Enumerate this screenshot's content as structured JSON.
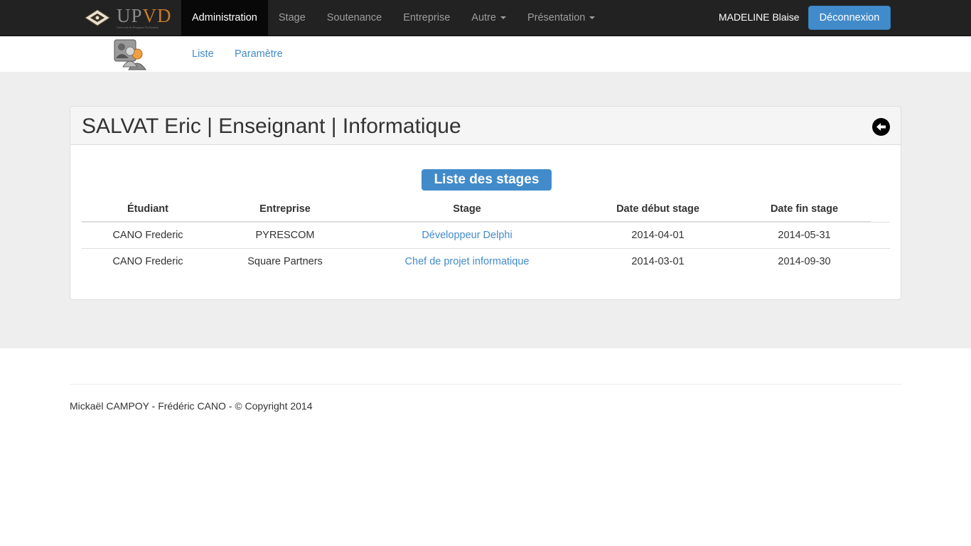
{
  "brand": {
    "letters_up": "UP",
    "letters_vd": "VD",
    "subtitle": "Université de Perpignan Via Domitia"
  },
  "nav": {
    "items": [
      {
        "label": "Administration",
        "active": true,
        "dropdown": false
      },
      {
        "label": "Stage",
        "active": false,
        "dropdown": false
      },
      {
        "label": "Soutenance",
        "active": false,
        "dropdown": false
      },
      {
        "label": "Entreprise",
        "active": false,
        "dropdown": false
      },
      {
        "label": "Autre",
        "active": false,
        "dropdown": true
      },
      {
        "label": "Présentation",
        "active": false,
        "dropdown": true
      }
    ],
    "user": "MADELINE Blaise",
    "logout": "Déconnexion"
  },
  "subnav": {
    "icon": "admin-users-icon",
    "links": [
      "Liste",
      "Paramètre"
    ]
  },
  "panel": {
    "title": "SALVAT Eric | Enseignant | Informatique",
    "back_icon": "arrow-left-circle-icon",
    "list_label": "Liste des stages"
  },
  "table": {
    "headers": [
      "Étudiant",
      "Entreprise",
      "Stage",
      "Date début stage",
      "Date fin stage"
    ],
    "rows": [
      [
        "CANO Frederic",
        "PYRESCOM",
        "Développeur Delphi",
        "2014-04-01",
        "2014-05-31"
      ],
      [
        "CANO Frederic",
        "Square Partners",
        "Chef de projet informatique",
        "2014-03-01",
        "2014-09-30"
      ]
    ]
  },
  "footer": {
    "text": "Mickaël CAMPOY - Frédéric CANO - © Copyright 2014"
  },
  "colors": {
    "navbar": "#222222",
    "accent": "#428bca",
    "band": "#eeeeee"
  }
}
